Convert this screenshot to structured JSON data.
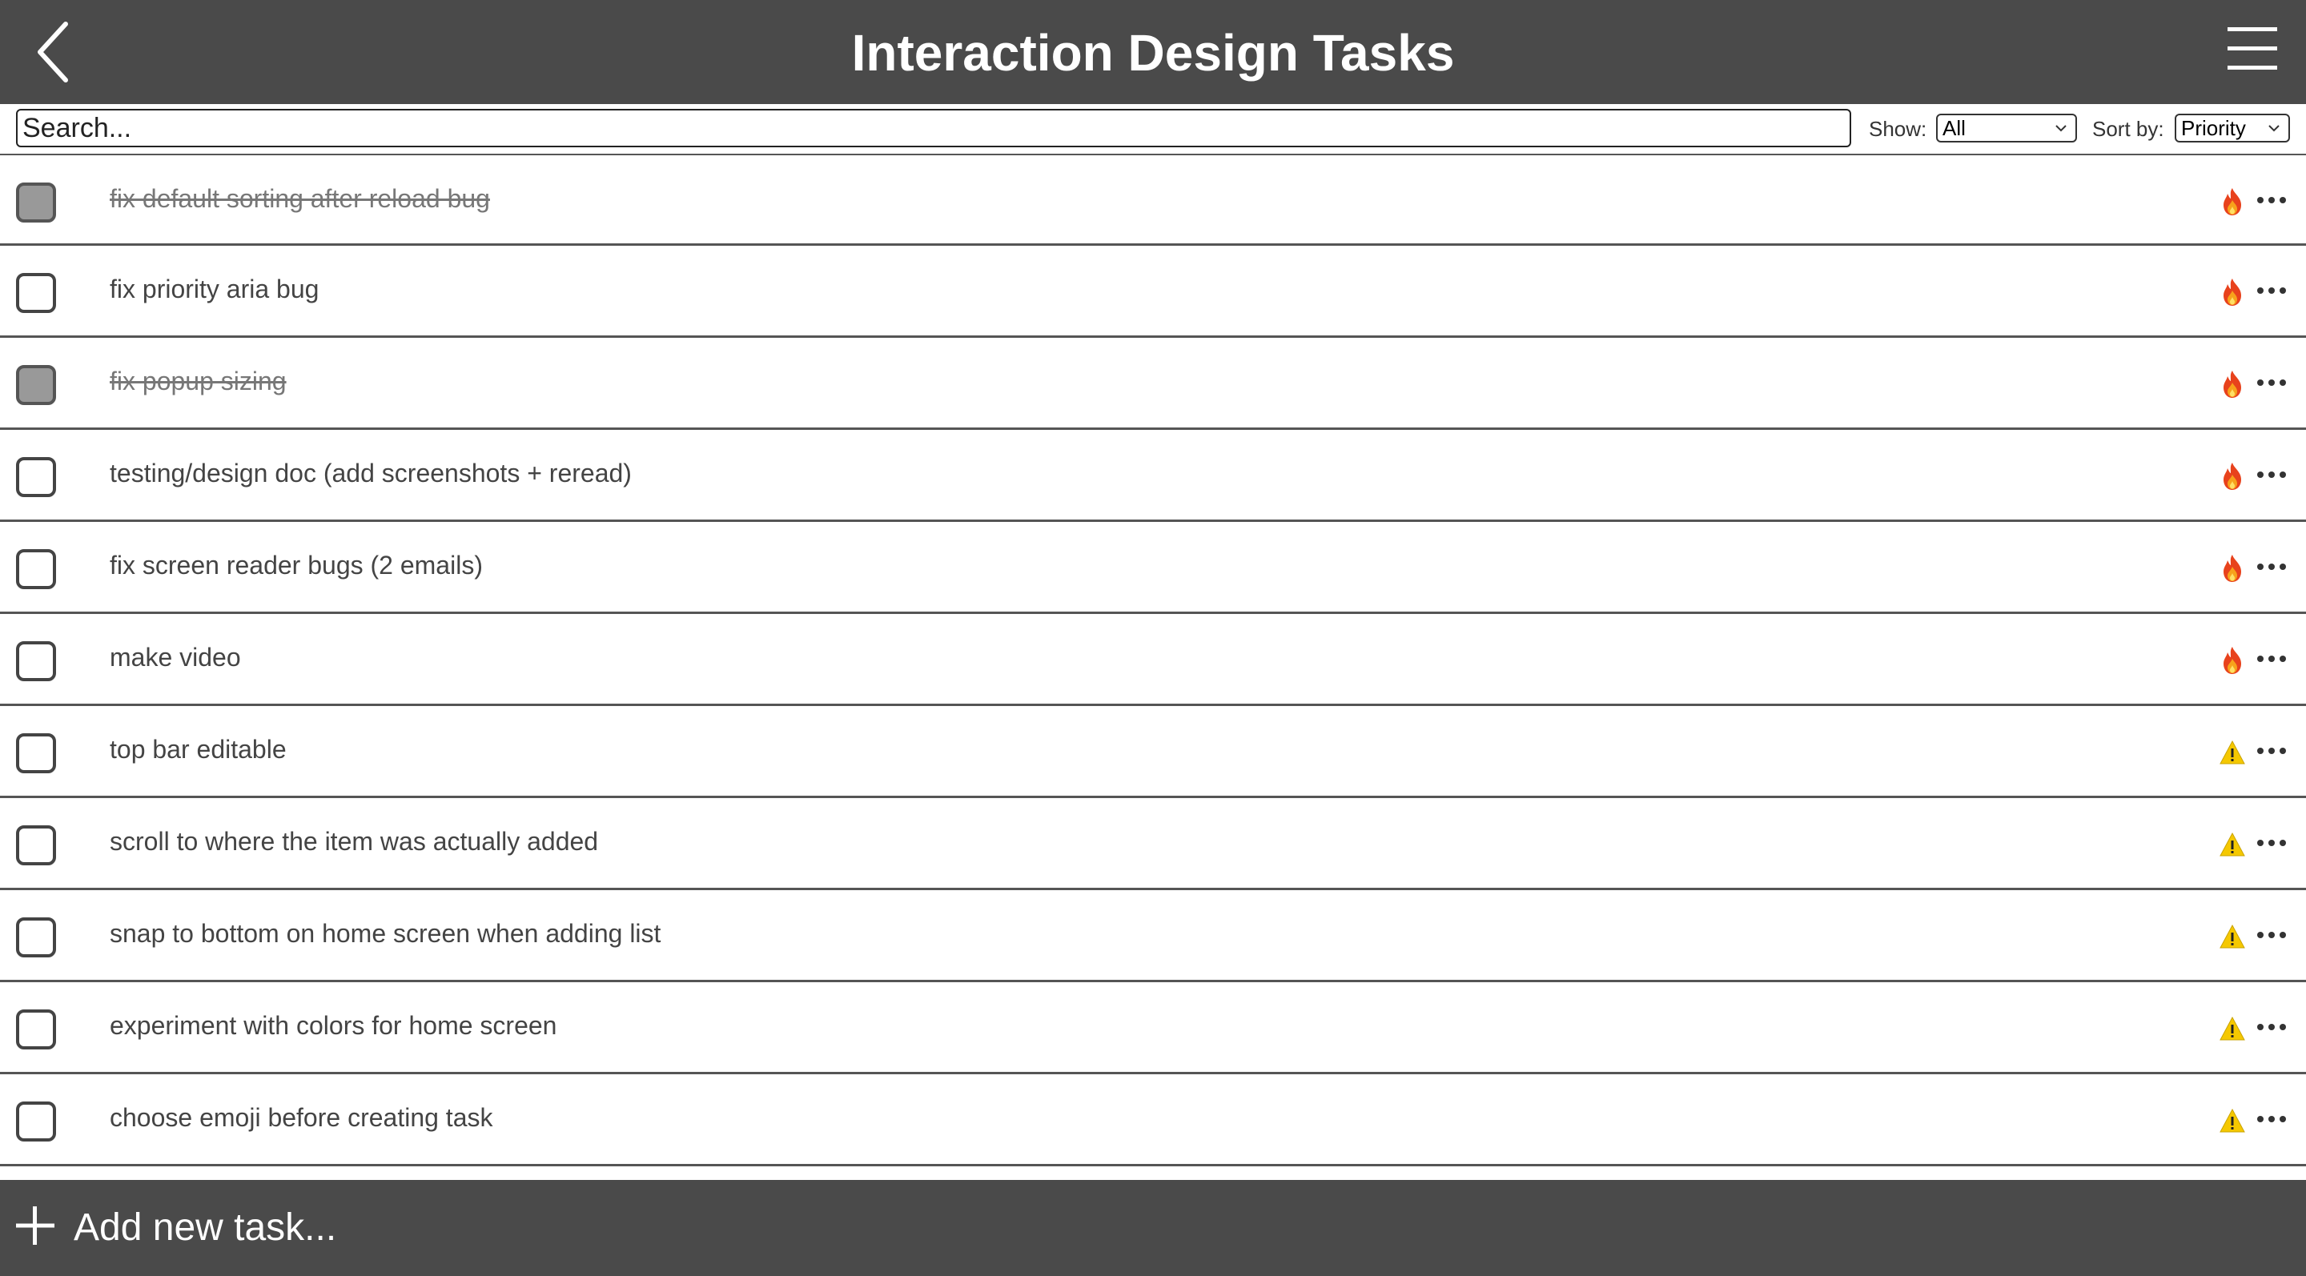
{
  "header": {
    "title": "Interaction Design Tasks",
    "back_icon": "chevron-left-icon",
    "menu_icon": "hamburger-menu-icon"
  },
  "toolbar": {
    "search_placeholder": "Search...",
    "show_label": "Show:",
    "show_value": "All",
    "sort_label": "Sort by:",
    "sort_value": "Priority"
  },
  "tasks": [
    {
      "text": "fix default sorting after reload bug",
      "done": true,
      "priority": "high",
      "priority_icon": "fire-icon"
    },
    {
      "text": "fix priority aria bug",
      "done": false,
      "priority": "high",
      "priority_icon": "fire-icon"
    },
    {
      "text": "fix popup sizing",
      "done": true,
      "priority": "high",
      "priority_icon": "fire-icon"
    },
    {
      "text": "testing/design doc (add screenshots + reread)",
      "done": false,
      "priority": "high",
      "priority_icon": "fire-icon"
    },
    {
      "text": "fix screen reader bugs (2 emails)",
      "done": false,
      "priority": "high",
      "priority_icon": "fire-icon"
    },
    {
      "text": "make video",
      "done": false,
      "priority": "high",
      "priority_icon": "fire-icon"
    },
    {
      "text": "top bar editable",
      "done": false,
      "priority": "medium",
      "priority_icon": "warning-icon"
    },
    {
      "text": "scroll to where the item was actually added",
      "done": false,
      "priority": "medium",
      "priority_icon": "warning-icon"
    },
    {
      "text": "snap to bottom on home screen when adding list",
      "done": false,
      "priority": "medium",
      "priority_icon": "warning-icon"
    },
    {
      "text": "experiment with colors for home screen",
      "done": false,
      "priority": "medium",
      "priority_icon": "warning-icon"
    },
    {
      "text": "choose emoji before creating task",
      "done": false,
      "priority": "medium",
      "priority_icon": "warning-icon"
    }
  ],
  "footer": {
    "add_label": "Add new task...",
    "add_icon": "plus-icon"
  },
  "colors": {
    "bar_background": "#4a4a4a",
    "checked_fill": "#999999",
    "fire": "#e8421c",
    "warning": "#f5c800"
  }
}
